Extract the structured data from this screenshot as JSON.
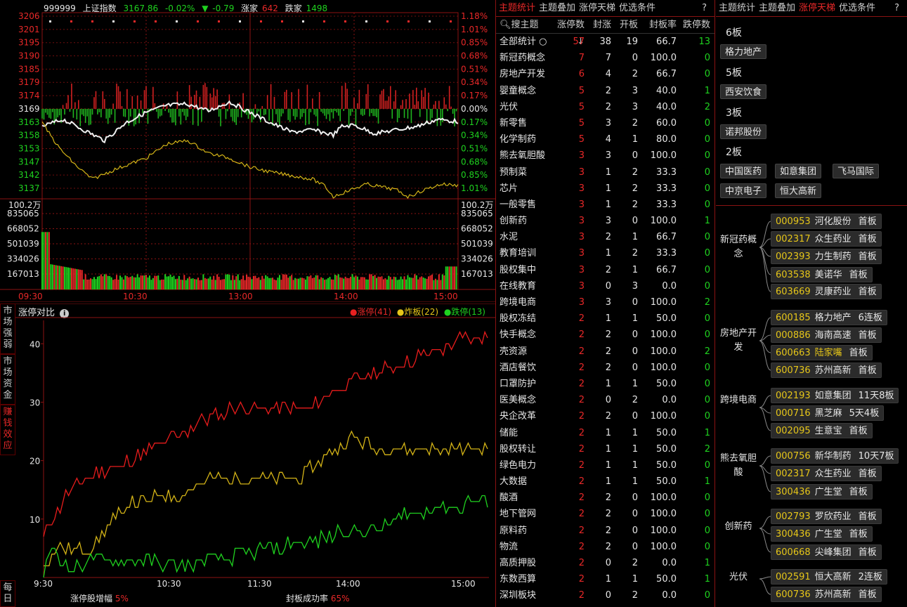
{
  "intraday": {
    "code": "999999",
    "name": "上证指数",
    "price": "3167.86",
    "change_pct": "-0.02%",
    "change_arrow": "▼",
    "change": "-0.79",
    "up_label": "涨家",
    "up_count": "642",
    "down_label": "跌家",
    "down_count": "1498",
    "price_axis": [
      "3206",
      "3201",
      "3195",
      "3190",
      "3185",
      "3179",
      "3174",
      "3169",
      "3163",
      "3158",
      "3153",
      "3147",
      "3142",
      "3137"
    ],
    "pct_axis": [
      "1.18%",
      "1.01%",
      "0.85%",
      "0.68%",
      "0.51%",
      "0.34%",
      "0.17%",
      "0.00%",
      "0.17%",
      "0.34%",
      "0.51%",
      "0.68%",
      "0.85%",
      "1.01%"
    ],
    "vol_unit": "100.2万",
    "vol_axis": [
      "835065",
      "668052",
      "501039",
      "334026",
      "167013"
    ],
    "time_axis": [
      "09:30",
      "10:30",
      "13:00",
      "14:00",
      "15:00"
    ]
  },
  "compare": {
    "title": "涨停对比",
    "legend": [
      {
        "label": "涨停(41)",
        "color": "#e82020"
      },
      {
        "label": "炸板(22)",
        "color": "#e6c619"
      },
      {
        "label": "跌停(13)",
        "color": "#1fd21f"
      }
    ],
    "y_ticks": [
      "40",
      "30",
      "20",
      "10"
    ],
    "x_ticks": [
      "9:30",
      "10:30",
      "11:30",
      "14:00",
      "15:00"
    ],
    "footer_label1": "涨停股增幅",
    "footer_val1": "5%",
    "footer_label2": "封板成功率",
    "footer_val2": "65%"
  },
  "side_tabs": [
    "市场强弱",
    "市场资金",
    "赚钱效应",
    "每日"
  ],
  "table": {
    "tabs": [
      "主题统计",
      "主题叠加",
      "涨停天梯",
      "优选条件"
    ],
    "help": "?",
    "search_label": "搜主题",
    "columns": [
      "涨停数↓",
      "封涨",
      "开板",
      "封板率",
      "跌停数"
    ],
    "rows": [
      [
        "全部统计",
        "57",
        "38",
        "19",
        "66.7",
        "13"
      ],
      [
        "新冠药概念",
        "7",
        "7",
        "0",
        "100.0",
        "0"
      ],
      [
        "房地产开发",
        "6",
        "4",
        "2",
        "66.7",
        "0"
      ],
      [
        "婴童概念",
        "5",
        "2",
        "3",
        "40.0",
        "1"
      ],
      [
        "光伏",
        "5",
        "2",
        "3",
        "40.0",
        "2"
      ],
      [
        "新零售",
        "5",
        "3",
        "2",
        "60.0",
        "0"
      ],
      [
        "化学制药",
        "5",
        "4",
        "1",
        "80.0",
        "0"
      ],
      [
        "熊去氧胆酸",
        "3",
        "3",
        "0",
        "100.0",
        "0"
      ],
      [
        "预制菜",
        "3",
        "1",
        "2",
        "33.3",
        "0"
      ],
      [
        "芯片",
        "3",
        "1",
        "2",
        "33.3",
        "0"
      ],
      [
        "一般零售",
        "3",
        "1",
        "2",
        "33.3",
        "0"
      ],
      [
        "创新药",
        "3",
        "3",
        "0",
        "100.0",
        "1"
      ],
      [
        "水泥",
        "3",
        "2",
        "1",
        "66.7",
        "0"
      ],
      [
        "教育培训",
        "3",
        "1",
        "2",
        "33.3",
        "0"
      ],
      [
        "股权集中",
        "3",
        "2",
        "1",
        "66.7",
        "0"
      ],
      [
        "在线教育",
        "3",
        "0",
        "3",
        "0.0",
        "0"
      ],
      [
        "跨境电商",
        "3",
        "3",
        "0",
        "100.0",
        "2"
      ],
      [
        "股权冻结",
        "2",
        "1",
        "1",
        "50.0",
        "0"
      ],
      [
        "快手概念",
        "2",
        "2",
        "0",
        "100.0",
        "0"
      ],
      [
        "壳资源",
        "2",
        "2",
        "0",
        "100.0",
        "2"
      ],
      [
        "酒店餐饮",
        "2",
        "2",
        "0",
        "100.0",
        "0"
      ],
      [
        "口罩防护",
        "2",
        "1",
        "1",
        "50.0",
        "0"
      ],
      [
        "医美概念",
        "2",
        "0",
        "2",
        "0.0",
        "0"
      ],
      [
        "央企改革",
        "2",
        "2",
        "0",
        "100.0",
        "0"
      ],
      [
        "储能",
        "2",
        "1",
        "1",
        "50.0",
        "1"
      ],
      [
        "股权转让",
        "2",
        "1",
        "1",
        "50.0",
        "2"
      ],
      [
        "绿色电力",
        "2",
        "1",
        "1",
        "50.0",
        "0"
      ],
      [
        "大数据",
        "2",
        "1",
        "1",
        "50.0",
        "1"
      ],
      [
        "酸酒",
        "2",
        "2",
        "0",
        "100.0",
        "0"
      ],
      [
        "地下管网",
        "2",
        "2",
        "0",
        "100.0",
        "0"
      ],
      [
        "原料药",
        "2",
        "2",
        "0",
        "100.0",
        "0"
      ],
      [
        "物流",
        "2",
        "2",
        "0",
        "100.0",
        "0"
      ],
      [
        "高质押股",
        "2",
        "0",
        "2",
        "0.0",
        "1"
      ],
      [
        "东数西算",
        "2",
        "1",
        "1",
        "50.0",
        "1"
      ],
      [
        "深圳板块",
        "2",
        "0",
        "2",
        "0.0",
        "0"
      ]
    ]
  },
  "ladder": {
    "tabs": [
      "主题统计",
      "主题叠加",
      "涨停天梯",
      "优选条件"
    ],
    "help": "?",
    "levels": [
      {
        "label": "6板",
        "stocks": [
          "格力地产"
        ]
      },
      {
        "label": "5板",
        "stocks": [
          "西安饮食"
        ]
      },
      {
        "label": "3板",
        "stocks": [
          "诺邦股份"
        ]
      },
      {
        "label": "2板",
        "stocks": [
          "中国医药",
          "如意集团",
          "飞马国际",
          "中京电子",
          "恒大高新"
        ]
      }
    ],
    "groups": [
      {
        "name": "新冠药概念",
        "stocks": [
          {
            "code": "000953",
            "name": "河化股份",
            "tag": "首板"
          },
          {
            "code": "002317",
            "name": "众生药业",
            "tag": "首板"
          },
          {
            "code": "002393",
            "name": "力生制药",
            "tag": "首板"
          },
          {
            "code": "603538",
            "name": "美诺华",
            "tag": "首板"
          },
          {
            "code": "603669",
            "name": "灵康药业",
            "tag": "首板"
          }
        ]
      },
      {
        "name": "房地产开发",
        "stocks": [
          {
            "code": "600185",
            "name": "格力地产",
            "tag": "6连板"
          },
          {
            "code": "000886",
            "name": "海南高速",
            "tag": "首板"
          },
          {
            "code": "600663",
            "name": "陆家嘴",
            "tag": "首板"
          },
          {
            "code": "600736",
            "name": "苏州高新",
            "tag": "首板"
          }
        ]
      },
      {
        "name": "跨境电商",
        "stocks": [
          {
            "code": "002193",
            "name": "如意集团",
            "tag": "11天8板"
          },
          {
            "code": "000716",
            "name": "黑芝麻",
            "tag": "5天4板"
          },
          {
            "code": "002095",
            "name": "生意宝",
            "tag": "首板"
          }
        ]
      },
      {
        "name": "熊去氧胆酸",
        "stocks": [
          {
            "code": "000756",
            "name": "新华制药",
            "tag": "10天7板"
          },
          {
            "code": "002317",
            "name": "众生药业",
            "tag": "首板"
          },
          {
            "code": "300436",
            "name": "广生堂",
            "tag": "首板"
          }
        ]
      },
      {
        "name": "创新药",
        "stocks": [
          {
            "code": "002793",
            "name": "罗欣药业",
            "tag": "首板"
          },
          {
            "code": "300436",
            "name": "广生堂",
            "tag": "首板"
          },
          {
            "code": "600668",
            "name": "尖峰集团",
            "tag": "首板"
          }
        ]
      },
      {
        "name": "光伏",
        "stocks": [
          {
            "code": "002591",
            "name": "恒大高新",
            "tag": "2连板"
          },
          {
            "code": "600736",
            "name": "苏州高新",
            "tag": "首板"
          }
        ]
      }
    ]
  },
  "colors": {
    "up": "#e82828",
    "down": "#1fd21f",
    "accent": "#e6c619",
    "grid": "#8b1212"
  }
}
